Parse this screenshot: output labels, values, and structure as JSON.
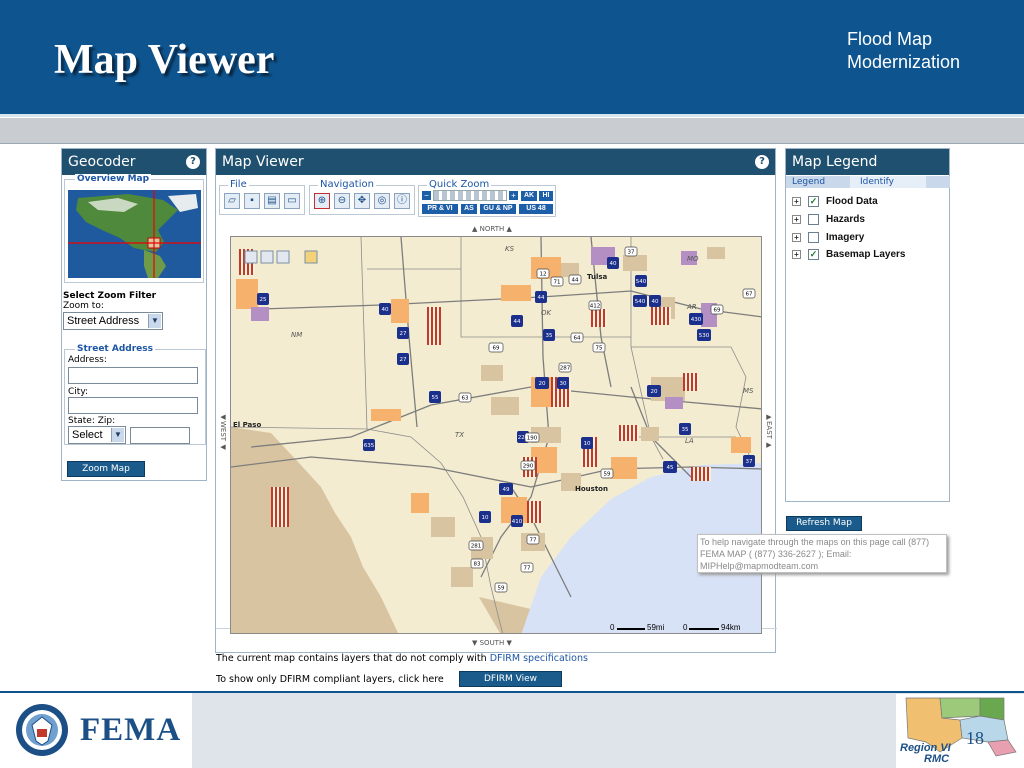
{
  "header": {
    "title": "Map Viewer",
    "subtitle_line1": "Flood Map",
    "subtitle_line2": "Modernization"
  },
  "geocoder": {
    "title": "Geocoder",
    "overview_label": "Overview Map",
    "zoom_filter_label": "Select Zoom Filter",
    "zoom_to_label": "Zoom to:",
    "zoom_to_value": "Street Address",
    "street_box_label": "Street Address",
    "address_label": "Address:",
    "city_label": "City:",
    "state_zip_label": "State:  Zip:",
    "state_value": "Select",
    "zoom_button": "Zoom Map"
  },
  "viewer": {
    "title": "Map Viewer",
    "group_file": "File",
    "group_navigation": "Navigation",
    "group_quick_zoom": "Quick Zoom",
    "qz_buttons": [
      "AK",
      "HI",
      "PR & VI",
      "AS",
      "GU & NP",
      "US 48"
    ],
    "north": "NORTH",
    "south": "SOUTH",
    "west": "WEST",
    "east": "EAST",
    "scale_mi": "59mi",
    "scale_km": "94km",
    "scale_zero": "0",
    "note_line1": "The current map contains layers that do not comply with",
    "note_link": "DFIRM specifications",
    "note_line2": "To show only DFIRM compliant layers, click here",
    "dfirm_button": "DFIRM View"
  },
  "map_labels": {
    "states": [
      "KS",
      "MO",
      "NM",
      "OK",
      "AR",
      "TX",
      "LA",
      "MS"
    ],
    "cities": [
      "Tulsa",
      "El Paso",
      "Houston"
    ],
    "routes": [
      "25",
      "40",
      "27",
      "27",
      "44",
      "44",
      "35",
      "40",
      "540",
      "540",
      "40",
      "430",
      "530",
      "55",
      "20",
      "30",
      "20",
      "635",
      "220",
      "10",
      "35",
      "45",
      "49",
      "10",
      "410",
      "37",
      "37",
      "12",
      "71",
      "44",
      "412",
      "64",
      "69",
      "287",
      "75",
      "69",
      "67",
      "63",
      "190",
      "290",
      "59",
      "77",
      "281",
      "83",
      "77",
      "59"
    ]
  },
  "legend": {
    "title": "Map Legend",
    "tab_legend": "Legend",
    "tab_identify": "Identify",
    "items": [
      {
        "label": "Flood Data",
        "checked": "✓"
      },
      {
        "label": "Hazards",
        "checked": ""
      },
      {
        "label": "Imagery",
        "checked": ""
      },
      {
        "label": "Basemap Layers",
        "checked": "✓"
      }
    ],
    "refresh_button": "Refresh Map"
  },
  "tooltip": {
    "line1": "To help navigate through the maps on this page call (877)",
    "line2": "FEMA MAP ( (877) 336-2627 ); Email:",
    "line3": "MIPHelp@mapmodteam.com"
  },
  "footer": {
    "fema": "FEMA",
    "region": "Region VI",
    "rmc": "RMC",
    "page": "18"
  }
}
